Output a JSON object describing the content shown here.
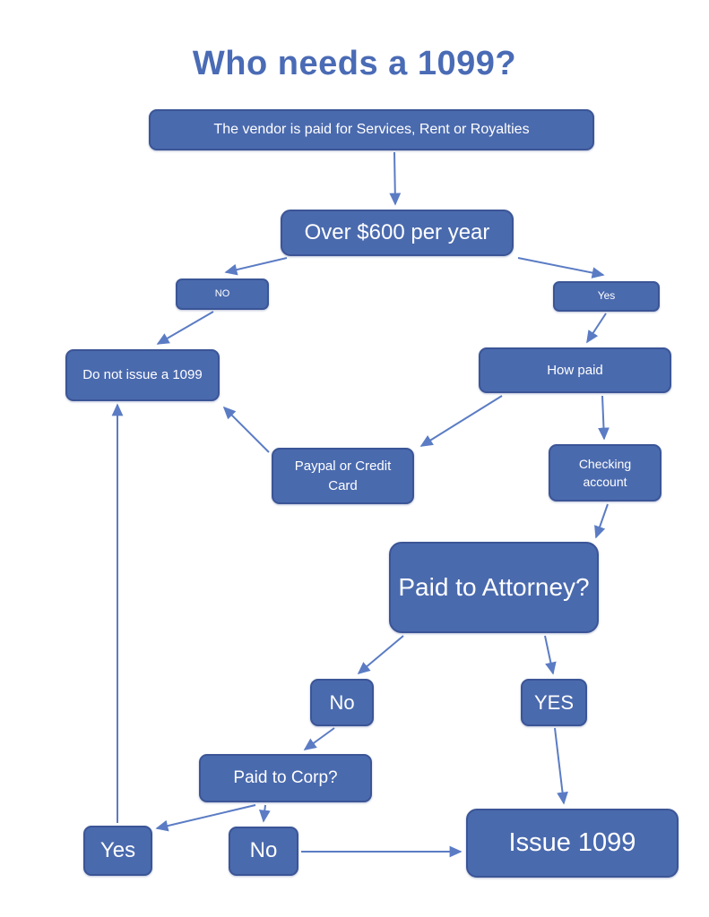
{
  "title": "Who needs a 1099?",
  "colors": {
    "node_fill": "#4a6aae",
    "node_border": "#3b5596",
    "node_text": "#ffffff",
    "title_text": "#4a6bb5",
    "arrow": "#5b7cc4",
    "background": "#ffffff"
  },
  "chart_data": {
    "type": "diagram",
    "title": "Who needs a 1099?",
    "nodes": [
      {
        "id": "vendor",
        "label": "The vendor is paid for Services, Rent or Royalties"
      },
      {
        "id": "over600",
        "label": "Over $600 per year"
      },
      {
        "id": "no1",
        "label": "NO"
      },
      {
        "id": "yes1",
        "label": "Yes"
      },
      {
        "id": "donot",
        "label": "Do not issue a 1099"
      },
      {
        "id": "howpaid",
        "label": "How paid"
      },
      {
        "id": "paypal",
        "label": "Paypal or Credit Card"
      },
      {
        "id": "checking",
        "label": "Checking account"
      },
      {
        "id": "attorney",
        "label": "Paid to Attorney?"
      },
      {
        "id": "no2",
        "label": "No"
      },
      {
        "id": "yes2",
        "label": "YES"
      },
      {
        "id": "corp",
        "label": "Paid to Corp?"
      },
      {
        "id": "yes3",
        "label": "Yes"
      },
      {
        "id": "no3",
        "label": "No"
      },
      {
        "id": "issue",
        "label": "Issue 1099"
      }
    ],
    "edges": [
      {
        "from": "vendor",
        "to": "over600"
      },
      {
        "from": "over600",
        "to": "no1"
      },
      {
        "from": "over600",
        "to": "yes1"
      },
      {
        "from": "no1",
        "to": "donot"
      },
      {
        "from": "yes1",
        "to": "howpaid"
      },
      {
        "from": "howpaid",
        "to": "paypal"
      },
      {
        "from": "howpaid",
        "to": "checking"
      },
      {
        "from": "paypal",
        "to": "donot"
      },
      {
        "from": "checking",
        "to": "attorney"
      },
      {
        "from": "attorney",
        "to": "no2"
      },
      {
        "from": "attorney",
        "to": "yes2"
      },
      {
        "from": "no2",
        "to": "corp"
      },
      {
        "from": "corp",
        "to": "yes3"
      },
      {
        "from": "corp",
        "to": "no3"
      },
      {
        "from": "yes3",
        "to": "donot"
      },
      {
        "from": "no3",
        "to": "issue"
      },
      {
        "from": "yes2",
        "to": "issue"
      }
    ]
  },
  "nodes": {
    "vendor": "The vendor is paid for Services, Rent or Royalties",
    "over600": "Over $600 per year",
    "no1": "NO",
    "yes1": "Yes",
    "donot": "Do not issue a 1099",
    "howpaid": "How paid",
    "paypal": "Paypal or Credit Card",
    "checking": "Checking account",
    "attorney": "Paid to Attorney?",
    "no2": "No",
    "yes2": "YES",
    "corp": "Paid to Corp?",
    "yes3": "Yes",
    "no3": "No",
    "issue": "Issue 1099"
  }
}
